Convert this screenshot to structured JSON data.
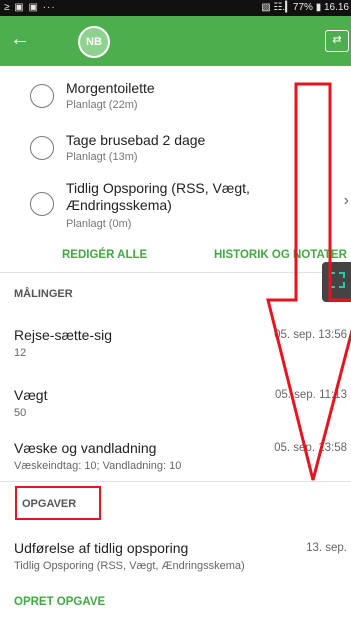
{
  "status_bar": {
    "left_text": "≥ ▣ ▣ ···",
    "right_text": "▧ ☷.▎77% ▮ 16.16"
  },
  "header": {
    "back_icon": "←",
    "avatar_initials": "NB",
    "switch_icon": "⇄"
  },
  "tasks": [
    {
      "title": "Morgentoilette",
      "status": "Planlagt (22m)"
    },
    {
      "title": "Tage brusebad 2 dage",
      "status": "Planlagt (13m)"
    },
    {
      "title": "Tidlig Opsporing (RSS, Vægt, Ændringsskema)",
      "status": "Planlagt (0m)"
    }
  ],
  "task_chevron": "›",
  "actions": {
    "edit_all": "REDIGÉR ALLE",
    "history": "HISTORIK OG NOTATER"
  },
  "measurements": {
    "heading": "MÅLINGER",
    "items": [
      {
        "name": "Rejse-sætte-sig",
        "value": "12",
        "time": "05. sep. 13:56"
      },
      {
        "name": "Vægt",
        "value": "50",
        "time": "05. sep. 11:13"
      },
      {
        "name": "Væske og vandladning",
        "value": "Væskeindtag: 10; Vandladning: 10",
        "time": "05. sep. 13:58"
      }
    ]
  },
  "tasks_section": {
    "heading": "OPGAVER",
    "item": {
      "name": "Udførelse af tidlig opsporing",
      "detail": "Tidlig Opsporing (RSS, Vægt, Ændringsskema)",
      "date": "13. sep."
    },
    "create_label": "OPRET OPGAVE"
  },
  "colors": {
    "app_bar": "#4cae4c",
    "accent_text": "#43a843",
    "annotation": "#e5141e"
  }
}
